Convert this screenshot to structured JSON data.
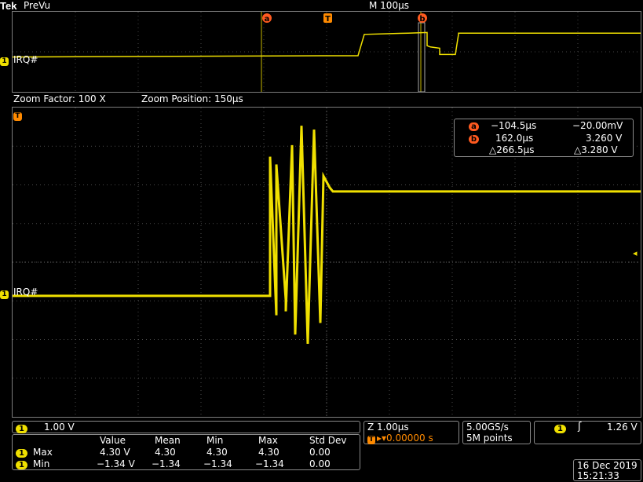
{
  "header": {
    "brand": "Tek",
    "mode": "PreVu",
    "timebase": "M 100µs"
  },
  "zoom": {
    "factor_label": "Zoom Factor: 100 X",
    "position_label": "Zoom Position: 150µs"
  },
  "markers": {
    "cursor_a": "a",
    "cursor_b": "b",
    "trigger": "T"
  },
  "channel": {
    "number": "1",
    "name": "IRQ#",
    "color": "#f0e000"
  },
  "cursor_readout": {
    "a_time": "−104.5µs",
    "a_value": "−20.00mV",
    "b_time": "162.0µs",
    "b_value": "3.260 V",
    "delta_time": "△266.5µs",
    "delta_value": "△3.280 V"
  },
  "ch1_scale": {
    "ch": "1",
    "scale": "1.00 V"
  },
  "zoom_timebase": {
    "label": "Z 1.00µs",
    "trigger_offset": "▸▾0.00000 s",
    "trigger_mark": "T"
  },
  "acquisition": {
    "rate": "5.00GS/s",
    "points": "5M points"
  },
  "trigger": {
    "ch": "1",
    "level": "1.26 V"
  },
  "measurements": {
    "headers": [
      "Value",
      "Mean",
      "Min",
      "Max",
      "Std Dev"
    ],
    "rows": [
      {
        "ch": "1",
        "name": "Max",
        "values": [
          "4.30 V",
          "4.30",
          "4.30",
          "4.30",
          "0.00"
        ]
      },
      {
        "ch": "1",
        "name": "Min",
        "values": [
          "−1.34 V",
          "−1.34",
          "−1.34",
          "−1.34",
          "0.00"
        ]
      }
    ]
  },
  "datetime": {
    "date": "16 Dec 2019",
    "time": "15:21:33"
  },
  "chart_data": {
    "type": "line",
    "overview": {
      "x_divisions": 10,
      "series": [
        {
          "x": [
            0,
            4.9,
            5.5,
            5.6,
            6.3,
            6.6,
            6.6,
            6.65,
            6.8,
            6.8,
            7.05,
            7.1,
            7.1,
            10
          ],
          "y": [
            0.4,
            0.5,
            0.5,
            2.2,
            2.3,
            2.35,
            1.3,
            1.2,
            1.1,
            0.6,
            0.6,
            2.2,
            2.3,
            2.3
          ]
        }
      ]
    },
    "zoom": {
      "x_divisions": 10,
      "y_divisions": 8,
      "series": [
        {
          "x": [
            0,
            4.1,
            4.1,
            4.2,
            4.2,
            4.35,
            4.35,
            4.45,
            4.5,
            4.6,
            4.7,
            4.8,
            4.9,
            4.95,
            5.05,
            5.1,
            10
          ],
          "y": [
            -0.1,
            -0.1,
            3.5,
            -0.6,
            3.3,
            -0.2,
            -0.5,
            3.8,
            -1.1,
            4.3,
            -1.34,
            4.2,
            -0.8,
            3.0,
            2.7,
            2.6,
            2.6
          ]
        }
      ]
    }
  }
}
